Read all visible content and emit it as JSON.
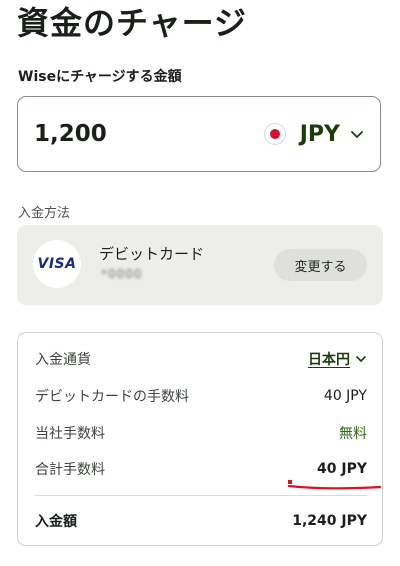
{
  "header": {
    "title": "資金のチャージ"
  },
  "amount": {
    "label": "Wiseにチャージする金額",
    "value": "1,200",
    "currency_code": "JPY",
    "flag_icon": "japan-flag-icon"
  },
  "payment_method": {
    "label": "入金方法",
    "brand": "VISA",
    "name": "デビットカード",
    "number_masked": "*0000",
    "change_label": "変更する"
  },
  "summary": {
    "rows": [
      {
        "label": "入金通貨",
        "value": "日本円"
      },
      {
        "label": "デビットカードの手数料",
        "value": "40 JPY"
      },
      {
        "label": "当社手数料",
        "value": "無料"
      },
      {
        "label": "合計手数料",
        "value": "40 JPY"
      }
    ],
    "total": {
      "label": "入金額",
      "value": "1,240 JPY"
    }
  },
  "colors": {
    "accent_green": "#1a3d0c",
    "free_green": "#2f6b12",
    "annotation_red": "#e0101f",
    "card_bg": "#edeee9"
  }
}
